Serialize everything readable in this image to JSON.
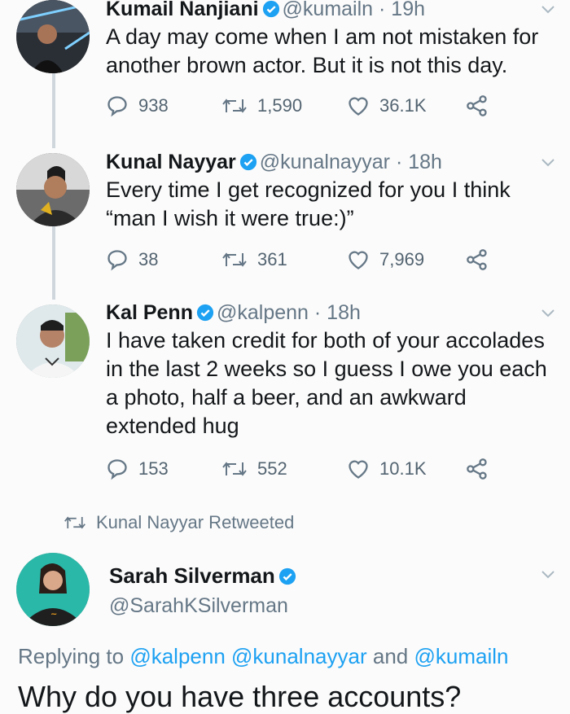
{
  "tweets": [
    {
      "name": "Kumail Nanjiani",
      "handle": "@kumailn",
      "time": "· 19h",
      "lines": [
        "A day may come when I am not mistaken for",
        "another brown actor. But it is not this day."
      ],
      "replies": "938",
      "retweets": "1,590",
      "likes": "36.1K"
    },
    {
      "name": "Kunal Nayyar",
      "handle": "@kunalnayyar",
      "time": "· 18h",
      "lines": [
        "Every time I get recognized for you I think",
        "“man I wish it were true:)”"
      ],
      "replies": "38",
      "retweets": "361",
      "likes": "7,969"
    },
    {
      "name": "Kal Penn",
      "handle": "@kalpenn",
      "time": "· 18h",
      "lines": [
        "I have taken credit for both of your accolades",
        "in the last 2 weeks so I guess I owe you each",
        "a photo, half a beer, and an awkward",
        "extended hug"
      ],
      "replies": "153",
      "retweets": "552",
      "likes": "10.1K"
    }
  ],
  "retweeted_label": "Kunal Nayyar Retweeted",
  "quoted": {
    "name": "Sarah Silverman",
    "handle": "@SarahKSilverman",
    "replying_prefix": "Replying to",
    "mention_1": "@kalpenn",
    "mention_2": "@kunalnayyar",
    "and_word": "and",
    "mention_3": "@kumailn",
    "text": "Why do you have three accounts?"
  },
  "colors": {
    "accent": "#1da1f2",
    "muted": "#657786",
    "thread": "#cfd6dc"
  },
  "icons": [
    "verified-icon",
    "reply-icon",
    "retweet-icon",
    "like-icon",
    "share-icon",
    "chevron-down-icon"
  ]
}
